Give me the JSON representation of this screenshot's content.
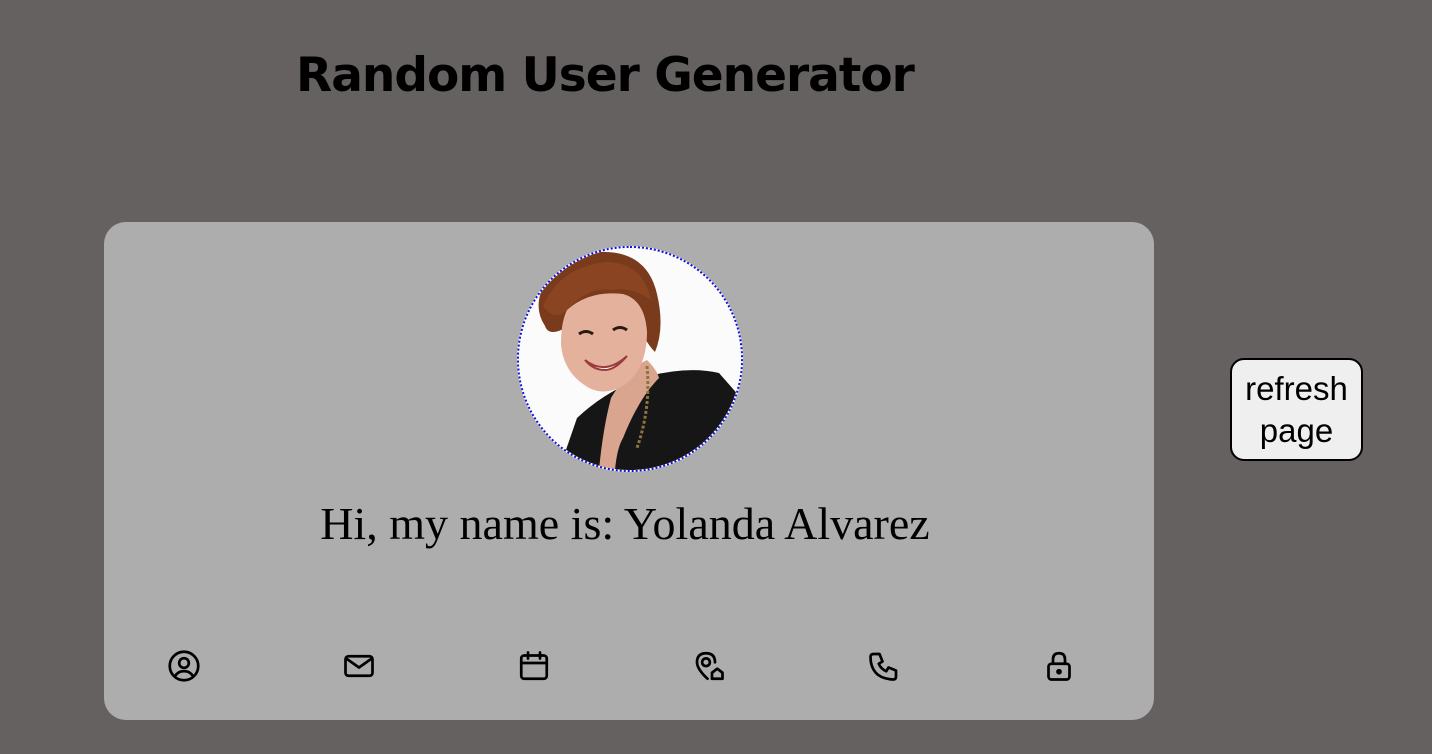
{
  "header": {
    "title": "Random User Generator"
  },
  "user": {
    "greeting": "Hi, my name is: Yolanda Alvarez",
    "avatar_icon": "user-photo"
  },
  "icons": [
    {
      "name": "user-icon"
    },
    {
      "name": "mail-icon"
    },
    {
      "name": "calendar-icon"
    },
    {
      "name": "location-icon"
    },
    {
      "name": "phone-icon"
    },
    {
      "name": "lock-icon"
    }
  ],
  "actions": {
    "refresh_label": "refresh page"
  },
  "colors": {
    "background": "#656160",
    "card": "#adadad",
    "avatar_border": "#1010e0",
    "button_bg": "#efefef"
  }
}
